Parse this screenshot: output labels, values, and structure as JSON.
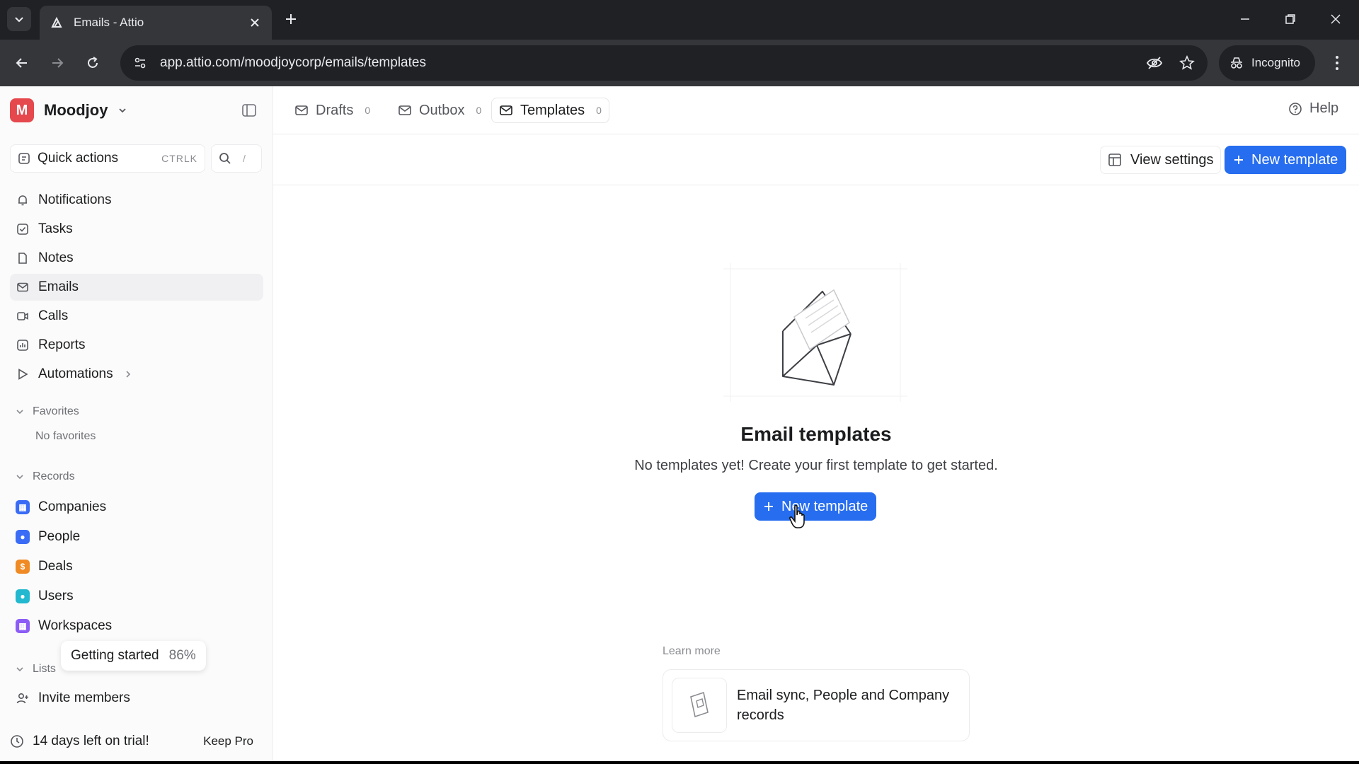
{
  "browser": {
    "tab_title": "Emails - Attio",
    "url": "app.attio.com/moodjoycorp/emails/templates",
    "incognito_label": "Incognito"
  },
  "sidebar": {
    "workspace_initial": "M",
    "workspace_name": "Moodjoy",
    "quick_actions_label": "Quick actions",
    "quick_actions_shortcut": "CTRLK",
    "search_shortcut": "/",
    "nav": [
      {
        "label": "Notifications",
        "icon": "bell-icon"
      },
      {
        "label": "Tasks",
        "icon": "checkbox-icon"
      },
      {
        "label": "Notes",
        "icon": "note-icon"
      },
      {
        "label": "Emails",
        "icon": "mail-icon"
      },
      {
        "label": "Calls",
        "icon": "video-icon"
      },
      {
        "label": "Reports",
        "icon": "chart-icon"
      },
      {
        "label": "Automations",
        "icon": "play-icon"
      }
    ],
    "favorites_label": "Favorites",
    "no_favorites": "No favorites",
    "records_label": "Records",
    "records": [
      {
        "label": "Companies",
        "color": "#3b6cf6"
      },
      {
        "label": "People",
        "color": "#3b6cf6"
      },
      {
        "label": "Deals",
        "color": "#f08a24"
      },
      {
        "label": "Users",
        "color": "#22b8cf"
      },
      {
        "label": "Workspaces",
        "color": "#8b5cf6"
      }
    ],
    "getting_started_label": "Getting started",
    "getting_started_pct": "86%",
    "lists_label": "Lists",
    "invite_label": "Invite members",
    "trial_text": "14 days left on trial!",
    "keep_pro": "Keep Pro"
  },
  "main": {
    "tabs": [
      {
        "label": "Drafts",
        "count": "0"
      },
      {
        "label": "Outbox",
        "count": "0"
      },
      {
        "label": "Templates",
        "count": "0"
      }
    ],
    "help_label": "Help",
    "view_settings_label": "View settings",
    "new_template_label": "New template",
    "empty_title": "Email templates",
    "empty_desc": "No templates yet! Create your first template to get started.",
    "empty_button_label": "New template",
    "learn_more_label": "Learn more",
    "learn_card_text": "Email sync, People and Company records"
  },
  "colors": {
    "accent": "#266df0",
    "workspace_logo": "#e5484d"
  }
}
